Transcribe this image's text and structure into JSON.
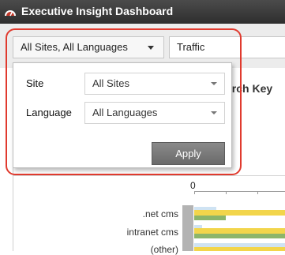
{
  "window": {
    "title": "Executive Insight Dashboard",
    "logo_icon": "dashboard-gauge-icon"
  },
  "toolbar": {
    "filter_button_label": "All Sites, All Languages",
    "tab_label": "Traffic"
  },
  "filter_popup": {
    "site": {
      "label": "Site",
      "value": "All Sites"
    },
    "language": {
      "label": "Language",
      "value": "All Languages"
    },
    "apply_label": "Apply"
  },
  "report": {
    "heading_partial": "arch Key",
    "chart": {
      "axis_zero_label": "0",
      "categories": [
        ".net cms",
        "intranet cms",
        "(other)"
      ]
    }
  },
  "colors": {
    "highlight": "#e03a2e",
    "bar_yellow": "#f2d54b",
    "bar_green": "#8cb56a",
    "bar_lightblue": "#cfe3f3"
  }
}
